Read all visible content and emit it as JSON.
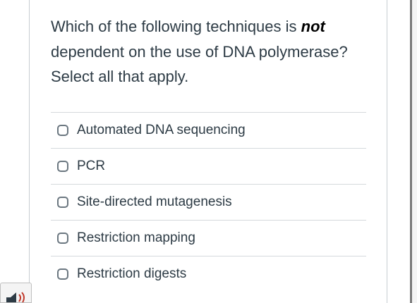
{
  "question": {
    "text_before": "Which of the following techniques is ",
    "emphasis": "not",
    "text_after": " dependent on the use of DNA polymerase? Select all that apply."
  },
  "answers": [
    {
      "label": "Automated DNA sequencing",
      "checked": false
    },
    {
      "label": "PCR",
      "checked": false
    },
    {
      "label": "Site-directed mutagenesis",
      "checked": false
    },
    {
      "label": "Restriction mapping",
      "checked": false
    },
    {
      "label": "Restriction digests",
      "checked": false
    }
  ],
  "icons": {
    "speaker": "speaker-icon"
  },
  "colors": {
    "text": "#2d3b45",
    "border": "#c7cdd1",
    "speaker_accent": "#c0392b"
  }
}
